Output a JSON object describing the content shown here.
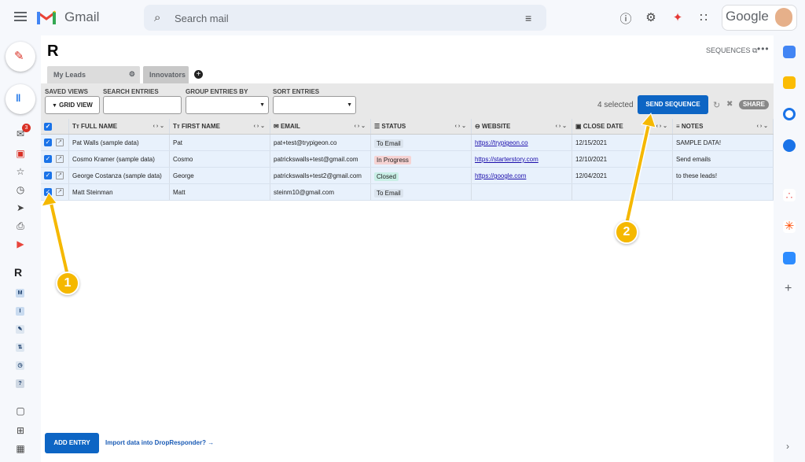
{
  "gmail": {
    "app_name": "Gmail",
    "search_placeholder": "Search mail",
    "google_word": "Google",
    "mail_badge": "3"
  },
  "dropresponder": {
    "sequences_link": "SEQUENCES",
    "tabs": [
      {
        "label": "My Leads"
      },
      {
        "label": "Innovators"
      }
    ],
    "toolbar": {
      "saved_views_label": "SAVED VIEWS",
      "saved_views_value": "GRID VIEW",
      "search_label": "SEARCH ENTRIES",
      "group_label": "GROUP ENTRIES BY",
      "sort_label": "SORT ENTRIES",
      "selected_text": "4 selected",
      "send_sequence": "SEND SEQUENCE",
      "share": "SHARE"
    },
    "columns": [
      {
        "icon": "Tт",
        "label": "FULL NAME"
      },
      {
        "icon": "Tт",
        "label": "FIRST NAME"
      },
      {
        "icon": "✉",
        "label": "EMAIL"
      },
      {
        "icon": "☰",
        "label": "STATUS"
      },
      {
        "icon": "⊖",
        "label": "WEBSITE"
      },
      {
        "icon": "▣",
        "label": "CLOSE DATE"
      },
      {
        "icon": "≡",
        "label": "NOTES"
      }
    ],
    "rows": [
      {
        "full_name": "Pat Walls (sample data)",
        "first_name": "Pat",
        "email": "pat+test@trypigeon.co",
        "status": "To Email",
        "website": "https://trypigeon.co",
        "close_date": "12/15/2021",
        "notes": "SAMPLE DATA!"
      },
      {
        "full_name": "Cosmo Kramer (sample data)",
        "first_name": "Cosmo",
        "email": "patrickswalls+test@gmail.com",
        "status": "In Progress",
        "website": "https://starterstory.com",
        "close_date": "12/10/2021",
        "notes": "Send emails"
      },
      {
        "full_name": "George Costanza (sample data)",
        "first_name": "George",
        "email": "patrickswalls+test2@gmail.com",
        "status": "Closed",
        "website": "https://google.com",
        "close_date": "12/04/2021",
        "notes": "to these leads!"
      },
      {
        "full_name": "Matt Steinman",
        "first_name": "Matt",
        "email": "steinm10@gmail.com",
        "status": "To Email",
        "website": "",
        "close_date": "",
        "notes": ""
      }
    ],
    "add_entry": "ADD ENTRY",
    "import_link": "Import data into DropResponder? →"
  },
  "callouts": [
    "1",
    "2"
  ],
  "colors": {
    "accent": "#0d65c4",
    "status_to_email": "#dbe4ee",
    "status_in_progress": "#f6d3d3",
    "status_closed": "#c9efe6",
    "callout": "#f5b800"
  }
}
